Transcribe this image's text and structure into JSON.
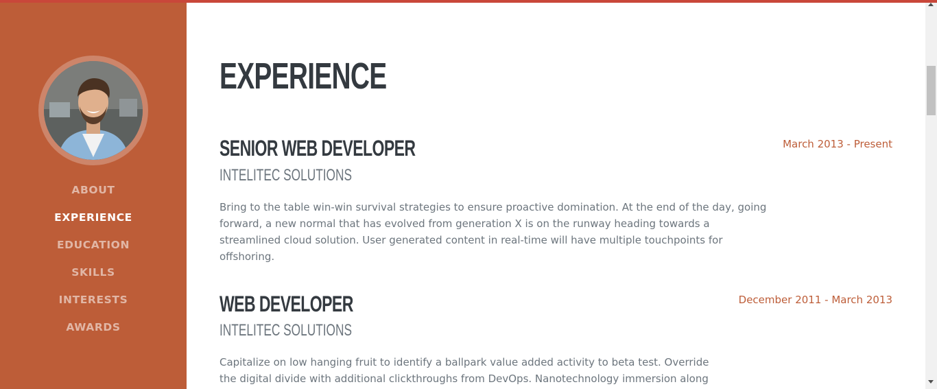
{
  "colors": {
    "accent": "#bd5d38",
    "heading": "#343a40",
    "muted": "#6c757d",
    "top_line": "#c9473a"
  },
  "sidebar": {
    "avatar_icon": "profile-photo",
    "nav": [
      {
        "label": "ABOUT",
        "active": false
      },
      {
        "label": "EXPERIENCE",
        "active": true
      },
      {
        "label": "EDUCATION",
        "active": false
      },
      {
        "label": "SKILLS",
        "active": false
      },
      {
        "label": "INTERESTS",
        "active": false
      },
      {
        "label": "AWARDS",
        "active": false
      }
    ]
  },
  "main": {
    "title": "EXPERIENCE",
    "jobs": [
      {
        "title": "SENIOR WEB DEVELOPER",
        "company": "INTELITEC SOLUTIONS",
        "date": "March 2013 - Present",
        "description": "Bring to the table win-win survival strategies to ensure proactive domination. At the end of the day, going forward, a new normal that has evolved from generation X is on the runway heading towards a streamlined cloud solution. User generated content in real-time will have multiple touchpoints for offshoring."
      },
      {
        "title": "WEB DEVELOPER",
        "company": "INTELITEC SOLUTIONS",
        "date": "December 2011 - March 2013",
        "description": "Capitalize on low hanging fruit to identify a ballpark value added activity to beta test. Override the digital divide with additional clickthroughs from DevOps. Nanotechnology immersion along the"
      }
    ]
  }
}
